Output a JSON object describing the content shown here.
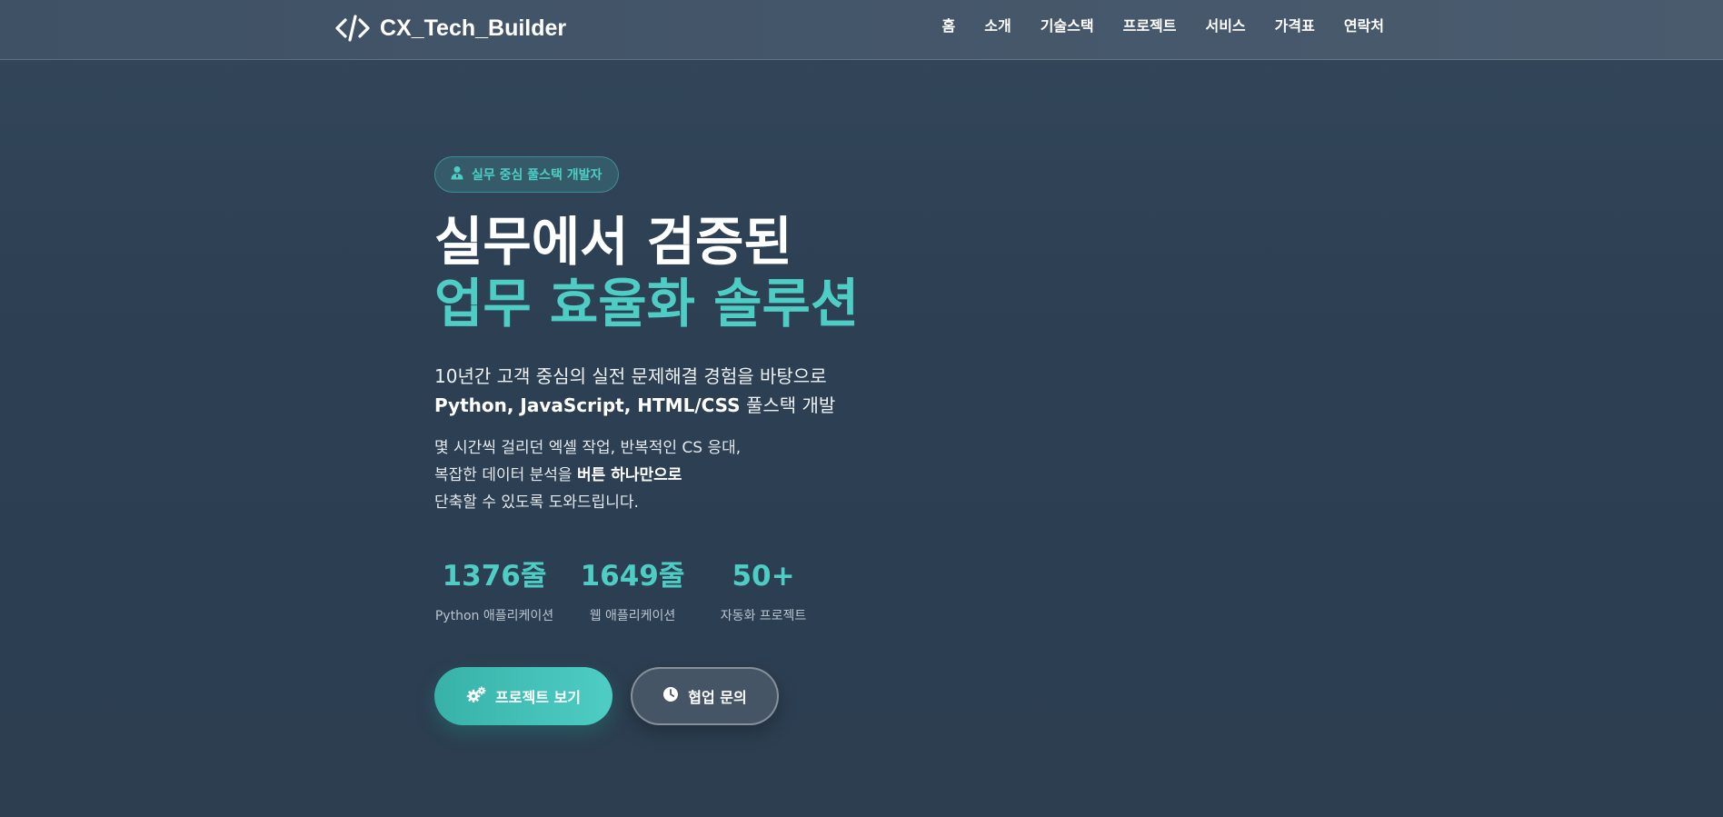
{
  "brand": {
    "name": "CX_Tech_Builder",
    "icon": "code-icon"
  },
  "nav": {
    "items": [
      {
        "label": "홈"
      },
      {
        "label": "소개"
      },
      {
        "label": "기술스택"
      },
      {
        "label": "프로젝트"
      },
      {
        "label": "서비스"
      },
      {
        "label": "가격표"
      },
      {
        "label": "연락처"
      }
    ]
  },
  "hero": {
    "badge": {
      "icon": "user-tie-icon",
      "text": "실무 중심 풀스택 개발자"
    },
    "title_line1": "실무에서 검증된",
    "title_line2": "업무 효율화 솔루션",
    "lead_line1": "10년간 고객 중심의 실전 문제해결 경험을 바탕으로",
    "lead_line2_bold": "Python, JavaScript, HTML/CSS",
    "lead_line2_rest": " 풀스택 개발",
    "desc_line1": "몇 시간씩 걸리던 엑셀 작업, 반복적인 CS 응대,",
    "desc_line2_pre": "복잡한 데이터 분석을 ",
    "desc_line2_bold": "버튼 하나만으로",
    "desc_line3": "단축할 수 있도록 도와드립니다."
  },
  "stats": [
    {
      "value": "1376줄",
      "label": "Python 애플리케이션"
    },
    {
      "value": "1649줄",
      "label": "웹 애플리케이션"
    },
    {
      "value": "50+",
      "label": "자동화 프로젝트"
    }
  ],
  "buttons": {
    "primary": {
      "label": "프로젝트 보기",
      "icon": "cogs-icon"
    },
    "secondary": {
      "label": "협업 문의",
      "icon": "clock-icon"
    }
  },
  "colors": {
    "accent": "#4ecdc4",
    "background": "#2c3e50"
  }
}
